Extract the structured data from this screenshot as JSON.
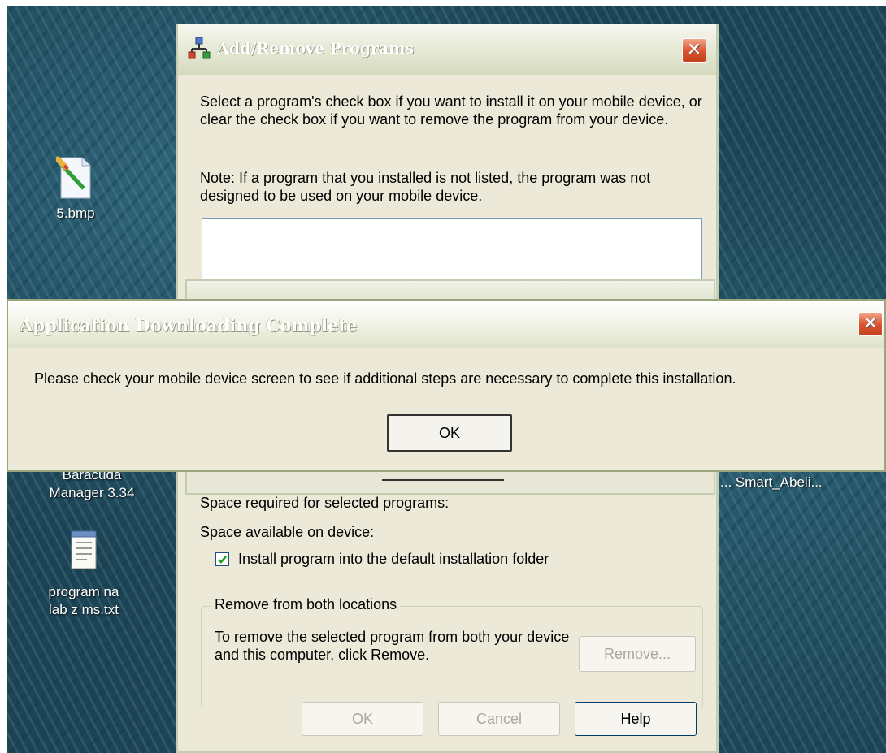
{
  "desktop": {
    "icons": [
      {
        "label": "5.bmp",
        "icon": "paint-bitmap-icon"
      },
      {
        "label_lines": [
          "Baracuda",
          "Manager 3.34"
        ],
        "icon": "app-icon"
      },
      {
        "label_lines": [
          "program na",
          "lab z ms.txt"
        ],
        "icon": "notepad-text-icon"
      },
      {
        "label": "... Smart_Abeli...",
        "icon": "app-icon"
      }
    ]
  },
  "main_window": {
    "title": "Add/Remove Programs",
    "close_glyph": "✕",
    "intro_text": "Select a program's check box if you want to install it on your mobile device, or clear the check box if you want to remove the program from your device.",
    "note_text": "Note:  If a program that you installed is not listed, the program was not designed to be used on your mobile device.",
    "space_required_label": "Space required for selected programs:",
    "space_available_label": "Space available on device:",
    "checkbox": {
      "label": "Install program into the default installation folder",
      "checked": true
    },
    "remove_group": {
      "legend": "Remove from both locations",
      "text": "To remove the selected program from both your device and this computer, click Remove.",
      "button": "Remove..."
    },
    "buttons": {
      "ok": "OK",
      "cancel": "Cancel",
      "help": "Help"
    }
  },
  "dialog": {
    "title": "Application Downloading Complete",
    "close_glyph": "✕",
    "message": "Please check your mobile device screen to see if additional steps are necessary to complete this installation.",
    "ok_button": "OK"
  },
  "colors": {
    "accent_close": "#d9522c",
    "window_face": "#ece9d8",
    "button_border": "#003c74",
    "desktop": "#1d4455"
  }
}
